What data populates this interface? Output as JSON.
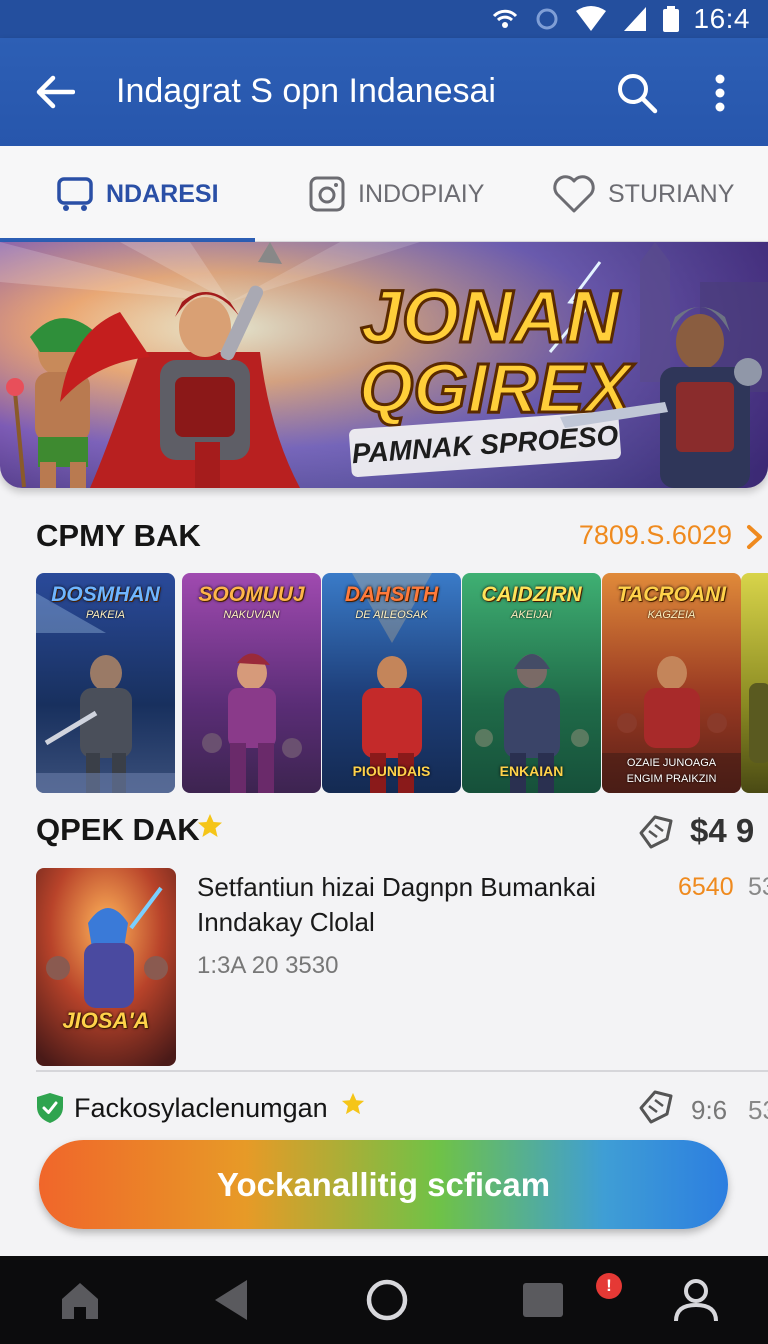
{
  "status_bar": {
    "time": "16:4"
  },
  "app_bar": {
    "title": "Indagrat S opn Indanesai"
  },
  "tabs": [
    {
      "label": "NDARESI",
      "icon": "cart-icon",
      "active": true
    },
    {
      "label": "INDOPIAIY",
      "icon": "camera-icon",
      "active": false
    },
    {
      "label": "STURIANY",
      "icon": "heart-icon",
      "active": false
    }
  ],
  "hero": {
    "title_line1": "JONAN",
    "title_line2": "QGIREX",
    "subtitle": "PAMNAK SPROESO"
  },
  "section1": {
    "title": "CPMY BAK",
    "link": "7809.S.6029",
    "cards": [
      {
        "title": "DOSMHAN",
        "subtitle": "PAKEIA",
        "label": ""
      },
      {
        "title": "SOOMUUJ",
        "subtitle": "NAKUVIAN",
        "label": ""
      },
      {
        "title": "DAHSITH",
        "subtitle": "DE AILEOSAK",
        "label": "PIOUNDAIS"
      },
      {
        "title": "CAIDZIRN",
        "subtitle": "AKEIJAI",
        "label": "ENKAIAN"
      },
      {
        "title": "TACROANI",
        "subtitle": "KAGZEIA",
        "label": "OZAIE JUNOAGA",
        "label2": "ENGIM PRAIKZIN"
      }
    ]
  },
  "section2": {
    "title": "QPEK DAK",
    "price": "$4 9",
    "item": {
      "thumb_label": "JIOSA'A",
      "title": "Setfantiun hizai Dagnpn Bumankai Inndakay Clolal",
      "meta": "1:3A  20 3530",
      "price": "6540",
      "price2": "53"
    }
  },
  "row3": {
    "label": "Fackosylaclenumgan",
    "value": "9:6",
    "value2": "53"
  },
  "cta": {
    "label": "Yockanallitig scficam"
  },
  "navbar": {
    "badge": "!"
  },
  "colors": {
    "primary": "#2d5fb5",
    "accent_orange": "#ef8a1e",
    "shield_green": "#2fa44f",
    "star_yellow": "#f5c518"
  }
}
